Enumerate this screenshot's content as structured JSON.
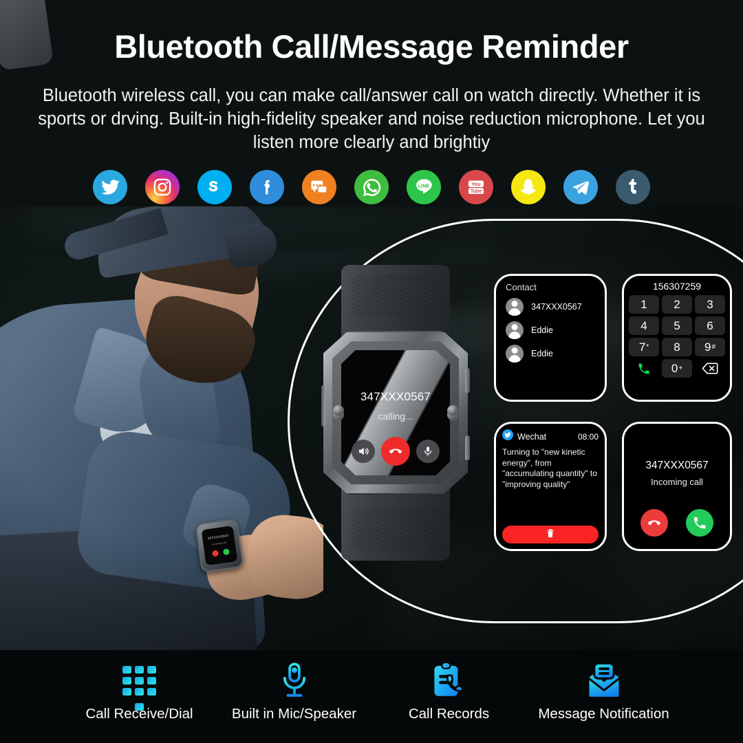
{
  "header": {
    "title": "Bluetooth Call/Message Reminder",
    "description": "Bluetooth wireless call, you can  make call/answer call on watch directly. Whether it is sports or drving. Built-in high-fidelity speaker and noise reduction microphone. Let you listen more clearly and brightiy"
  },
  "social_apps": [
    {
      "name": "twitter",
      "label": "Twitter",
      "color": "#2aa9e0"
    },
    {
      "name": "instagram",
      "label": "Instagram",
      "color": "#d6249f"
    },
    {
      "name": "skype",
      "label": "Skype",
      "color": "#00aff0"
    },
    {
      "name": "facebook",
      "label": "Facebook",
      "color": "#2f8ddb"
    },
    {
      "name": "messages",
      "label": "Messages",
      "color": "#f08020"
    },
    {
      "name": "whatsapp",
      "label": "WhatsApp",
      "color": "#3fbd3f"
    },
    {
      "name": "line",
      "label": "LINE",
      "color": "#2ec64a"
    },
    {
      "name": "youtube",
      "label": "YouTube",
      "color": "#d8484a"
    },
    {
      "name": "snapchat",
      "label": "Snapchat",
      "color": "#f5e812"
    },
    {
      "name": "telegram",
      "label": "Telegram",
      "color": "#3ba2e0"
    },
    {
      "name": "tumblr",
      "label": "Tumblr",
      "color": "#3a5a70"
    }
  ],
  "watch_screen": {
    "number": "347XXX0567",
    "status": "calling...",
    "buttons": [
      {
        "name": "speaker",
        "icon": "speaker-icon"
      },
      {
        "name": "end-call",
        "icon": "end-call-icon"
      },
      {
        "name": "microphone",
        "icon": "microphone-icon"
      }
    ]
  },
  "wrist_watch": {
    "number": "347XXX0567",
    "status": "Incoming call"
  },
  "cards": {
    "contact": {
      "title": "Contact",
      "entries": [
        {
          "name": "347XXX0567"
        },
        {
          "name": "Eddie"
        },
        {
          "name": "Eddie"
        }
      ]
    },
    "dialer": {
      "display": "156307259",
      "keys": [
        {
          "main": "1",
          "sup": ""
        },
        {
          "main": "2",
          "sup": ""
        },
        {
          "main": "3",
          "sup": ""
        },
        {
          "main": "4",
          "sup": ""
        },
        {
          "main": "5",
          "sup": ""
        },
        {
          "main": "6",
          "sup": ""
        },
        {
          "main": "7",
          "sup": "*"
        },
        {
          "main": "8",
          "sup": ""
        },
        {
          "main": "9",
          "sup": "#"
        },
        {
          "main": "0",
          "sup": "+"
        }
      ],
      "call_icon": "phone-icon",
      "backspace_icon": "backspace-icon"
    },
    "message": {
      "app": "Wechat",
      "time": "08:00",
      "body": "Turning to \"new kinetic energy\", from \"accumulating quantity\" to \"improving quality\"",
      "delete_icon": "trash-icon"
    },
    "incoming": {
      "number": "347XXX0567",
      "status": "Incoming call",
      "reject_icon": "reject-call-icon",
      "accept_icon": "accept-call-icon"
    }
  },
  "features": [
    {
      "label": "Call Receive/Dial",
      "icon": "keypad-icon"
    },
    {
      "label": "Built in Mic/Speaker",
      "icon": "microphone-icon"
    },
    {
      "label": "Call Records",
      "icon": "call-records-icon"
    },
    {
      "label": "Message Notification",
      "icon": "message-envelope-icon"
    }
  ],
  "colors": {
    "background": "#0c1212",
    "accent_cyan": "#17a8f0",
    "accent_teal": "#2fe7e0",
    "call_red": "#ef2b2b",
    "call_green": "#23cc5a"
  }
}
